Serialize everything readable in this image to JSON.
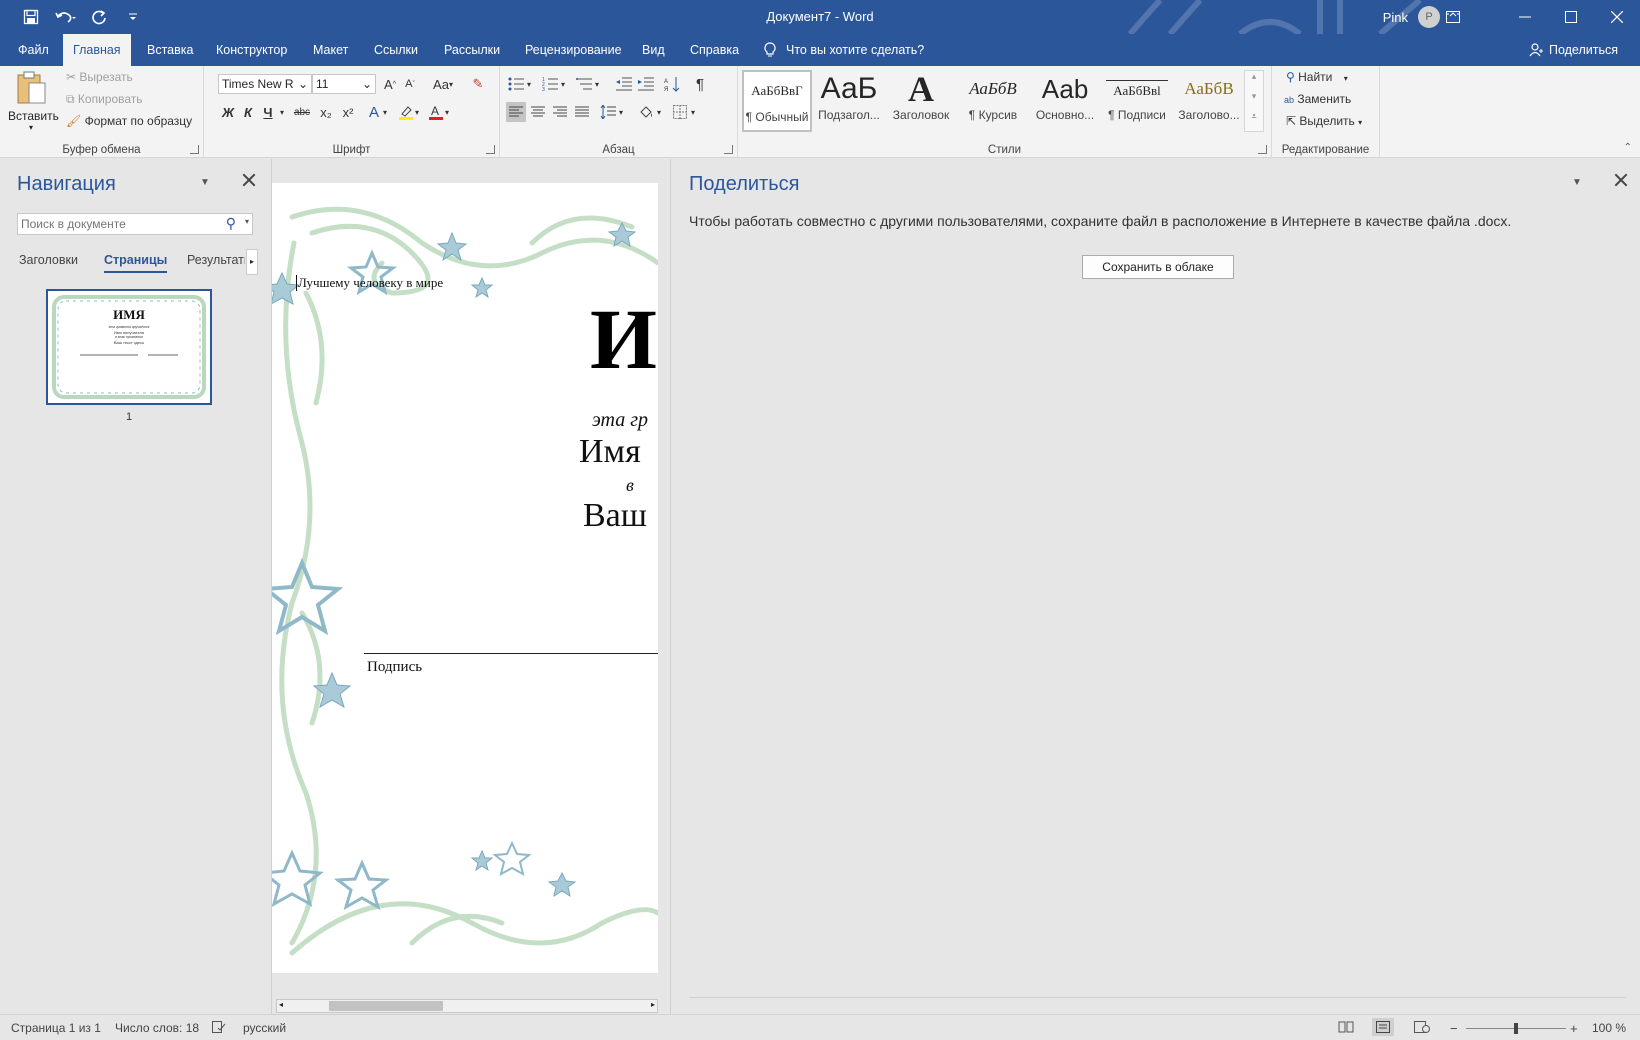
{
  "window": {
    "title": "Документ7  -  Word",
    "user_name": "Pink",
    "avatar_initial": "P"
  },
  "menu": {
    "tabs": [
      "Файл",
      "Главная",
      "Вставка",
      "Конструктор",
      "Макет",
      "Ссылки",
      "Рассылки",
      "Рецензирование",
      "Вид",
      "Справка"
    ],
    "active_tab": "Главная",
    "tell_me": "Что вы хотите сделать?",
    "share": "Поделиться"
  },
  "ribbon": {
    "clipboard": {
      "paste": "Вставить",
      "cut": "Вырезать",
      "copy": "Копировать",
      "format_painter": "Формат по образцу",
      "label": "Буфер обмена"
    },
    "font": {
      "font_name": "Times New R",
      "font_size": "11",
      "change_case": "Aa",
      "bold": "Ж",
      "italic": "К",
      "underline": "Ч",
      "strike": "abc",
      "subscript": "x₂",
      "superscript": "x²",
      "label": "Шрифт"
    },
    "paragraph": {
      "label": "Абзац"
    },
    "styles": {
      "label": "Стили",
      "items": [
        {
          "sample": "АаБбВвГ",
          "name": "¶ Обычный"
        },
        {
          "sample": "АаБ",
          "name": "Подзагол..."
        },
        {
          "sample": "А",
          "name": "Заголовок"
        },
        {
          "sample": "АаБбВ",
          "name": "¶ Курсив"
        },
        {
          "sample": "Ааb",
          "name": "Основно..."
        },
        {
          "sample": "АаБбВвl",
          "name": "¶ Подписи"
        },
        {
          "sample": "АаБбВ",
          "name": "Заголово..."
        }
      ]
    },
    "editing": {
      "find": "Найти",
      "replace": "Заменить",
      "select": "Выделить",
      "label": "Редактирование"
    }
  },
  "navigation": {
    "title": "Навигация",
    "search_placeholder": "Поиск в документе",
    "tabs": [
      "Заголовки",
      "Страницы",
      "Результать"
    ],
    "active_tab": "Страницы",
    "page_number": "1",
    "thumb": {
      "title": "ИМЯ",
      "lines": [
        "эта грамота вручается",
        "Имя получателя",
        "в знак признания",
        "Ваш текст здесь"
      ]
    }
  },
  "document": {
    "top_line": "Лучшему человеку в мире",
    "big_letter": "И",
    "line1": "эта гр",
    "line2": "Имя",
    "line3": "в",
    "line4": "Ваш",
    "signature": "Подпись"
  },
  "share_pane": {
    "title": "Поделиться",
    "message": "Чтобы работать совместно с другими пользователями, сохраните файл в расположение в Интернете в качестве файла .docx.",
    "button": "Сохранить в облаке"
  },
  "status": {
    "page": "Страница 1 из 1",
    "words": "Число слов: 18",
    "language": "русский",
    "zoom": "100 %"
  },
  "colors": {
    "accent": "#2b579a",
    "ribbon": "#f3f3f3",
    "pane": "#e6e6e6",
    "swirl": "#b9d8bd",
    "star": "#8fb8c9"
  }
}
